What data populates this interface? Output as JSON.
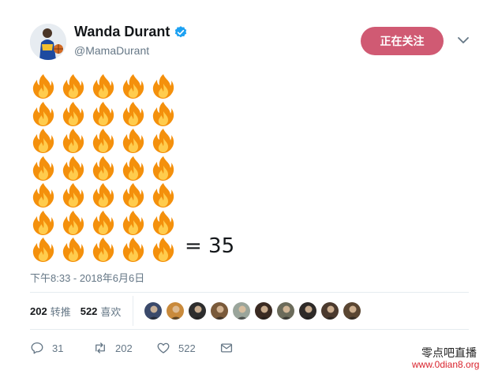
{
  "tweet": {
    "author": {
      "display_name": "Wanda Durant",
      "handle": "@MamaDurant",
      "verified": true,
      "avatar_icon": "basketball-player-avatar"
    },
    "follow_button_label": "正在关注",
    "menu_icon": "chevron-down-icon",
    "body": {
      "emoji": "🔥",
      "emoji_rows": 7,
      "emoji_per_row": 5,
      "equals_text": "= 35"
    },
    "timestamp": "下午8:33 - 2018年6月6日",
    "stats": {
      "retweets_count": "202",
      "retweets_label": "转推",
      "likes_count": "522",
      "likes_label": "喜欢"
    },
    "liker_avatars_count": 10,
    "actions": {
      "reply_count": "31",
      "retweet_count": "202",
      "like_count": "522"
    }
  },
  "watermark": {
    "line1": "零点吧直播",
    "line2": "www.0dian8.org"
  },
  "colors": {
    "follow_button": "#d05a73",
    "verified": "#1da1f2",
    "muted_text": "#657786",
    "watermark_url": "#d9232d"
  }
}
